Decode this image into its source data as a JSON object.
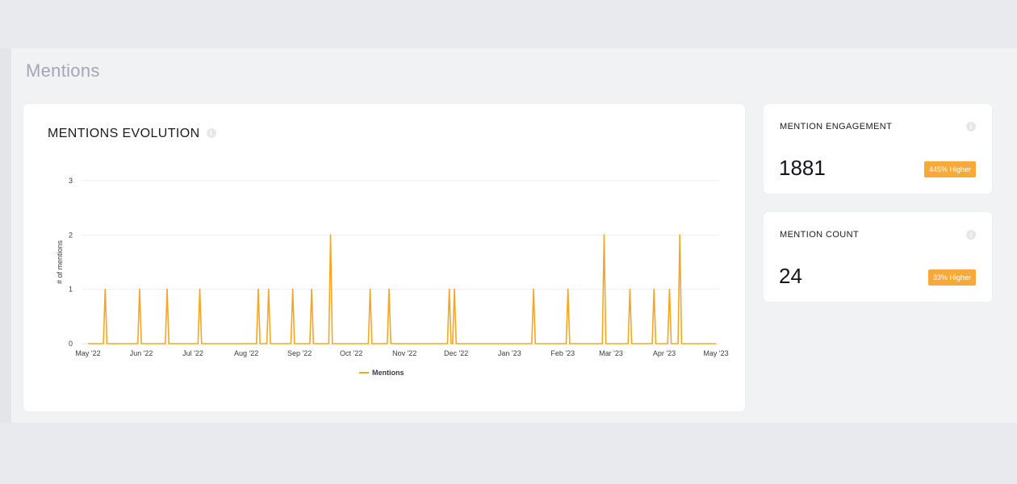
{
  "page": {
    "title": "Mentions"
  },
  "chart_card": {
    "title": "MENTIONS EVOLUTION"
  },
  "stats": [
    {
      "label": "MENTION ENGAGEMENT",
      "value": "1881",
      "badge": "445% Higher"
    },
    {
      "label": "MENTION COUNT",
      "value": "24",
      "badge": "33% Higher"
    }
  ],
  "colors": {
    "accent": "#f7a93a",
    "line": "#f5a623",
    "text": "#1b1b22",
    "muted": "#a3a6b4"
  },
  "chart_data": {
    "type": "line",
    "title": "",
    "xlabel": "",
    "ylabel": "# of mentions",
    "ylim": [
      0,
      3
    ],
    "yticks": [
      0,
      1,
      2,
      3
    ],
    "xlim": [
      "2022-05-01",
      "2023-05-01"
    ],
    "xticks": [
      {
        "label": "May '22",
        "date": "2022-05-01"
      },
      {
        "label": "Jun '22",
        "date": "2022-06-01"
      },
      {
        "label": "Jul '22",
        "date": "2022-07-01"
      },
      {
        "label": "Aug '22",
        "date": "2022-08-01"
      },
      {
        "label": "Sep '22",
        "date": "2022-09-01"
      },
      {
        "label": "Oct '22",
        "date": "2022-10-01"
      },
      {
        "label": "Nov '22",
        "date": "2022-11-01"
      },
      {
        "label": "Dec '22",
        "date": "2022-12-01"
      },
      {
        "label": "Jan '23",
        "date": "2023-01-01"
      },
      {
        "label": "Feb '23",
        "date": "2023-02-01"
      },
      {
        "label": "Mar '23",
        "date": "2023-03-01"
      },
      {
        "label": "Apr '23",
        "date": "2023-04-01"
      },
      {
        "label": "May '23",
        "date": "2023-05-01"
      }
    ],
    "grid": true,
    "legend": "bottom-center",
    "series": [
      {
        "name": "Mentions",
        "color": "#f5a623",
        "points": [
          {
            "x": "2022-05-11",
            "y": 1
          },
          {
            "x": "2022-05-31",
            "y": 1
          },
          {
            "x": "2022-06-16",
            "y": 1
          },
          {
            "x": "2022-07-05",
            "y": 1
          },
          {
            "x": "2022-08-08",
            "y": 1
          },
          {
            "x": "2022-08-14",
            "y": 1
          },
          {
            "x": "2022-08-28",
            "y": 1
          },
          {
            "x": "2022-09-08",
            "y": 1
          },
          {
            "x": "2022-09-19",
            "y": 2
          },
          {
            "x": "2022-10-12",
            "y": 1
          },
          {
            "x": "2022-10-23",
            "y": 1
          },
          {
            "x": "2022-11-27",
            "y": 1
          },
          {
            "x": "2022-11-30",
            "y": 1
          },
          {
            "x": "2023-01-15",
            "y": 1
          },
          {
            "x": "2023-02-04",
            "y": 1
          },
          {
            "x": "2023-02-25",
            "y": 2
          },
          {
            "x": "2023-03-12",
            "y": 1
          },
          {
            "x": "2023-03-26",
            "y": 1
          },
          {
            "x": "2023-04-04",
            "y": 1
          },
          {
            "x": "2023-04-10",
            "y": 2
          }
        ]
      }
    ]
  }
}
